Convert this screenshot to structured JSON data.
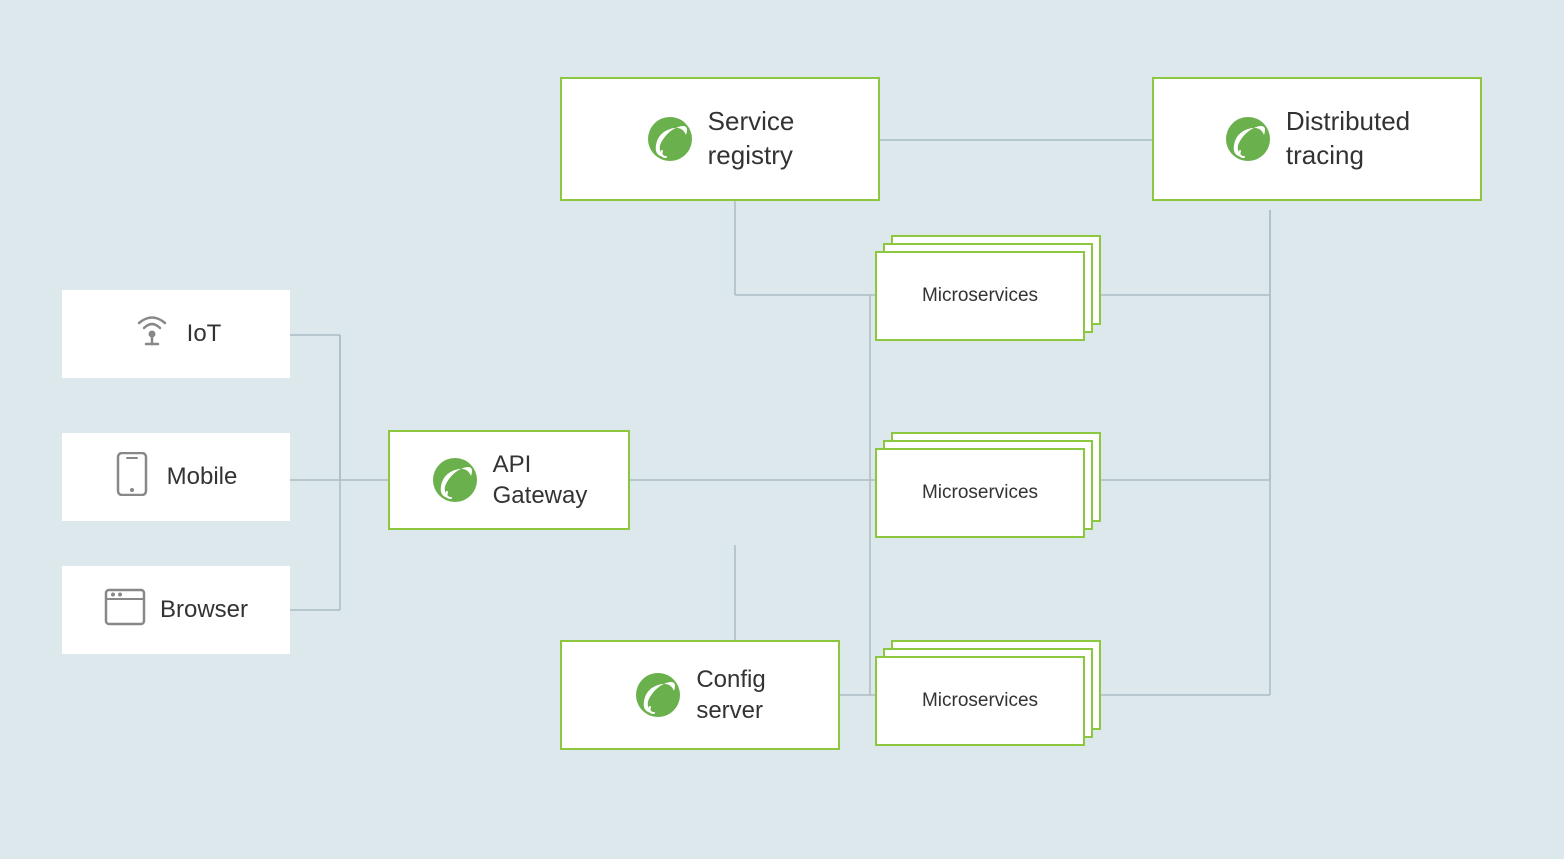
{
  "boxes": {
    "iot": {
      "label": "IoT"
    },
    "mobile": {
      "label": "Mobile"
    },
    "browser": {
      "label": "Browser"
    },
    "api_gateway": {
      "label": "API\nGateway",
      "label_line1": "API",
      "label_line2": "Gateway"
    },
    "service_registry": {
      "label": "Service\nregistry",
      "label_line1": "Service",
      "label_line2": "registry"
    },
    "distributed_tracing": {
      "label": "Distributed\ntracing",
      "label_line1": "Distributed",
      "label_line2": "tracing"
    },
    "config_server": {
      "label": "Config\nserver",
      "label_line1": "Config",
      "label_line2": "server"
    },
    "microservices1": {
      "label": "Microservices"
    },
    "microservices2": {
      "label": "Microservices"
    },
    "microservices3": {
      "label": "Microservices"
    }
  },
  "colors": {
    "spring_green": "#6ab04c",
    "border_green": "#8dc63f",
    "bg": "#dde8ec",
    "line": "#aabcc4"
  }
}
